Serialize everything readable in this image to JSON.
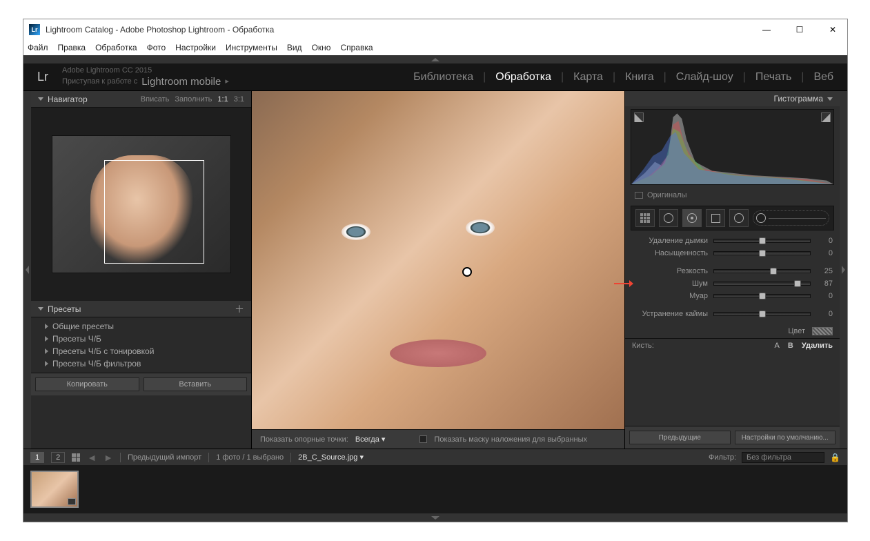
{
  "window": {
    "title": "Lightroom Catalog - Adobe Photoshop Lightroom - Обработка"
  },
  "menubar": [
    "Файл",
    "Правка",
    "Обработка",
    "Фото",
    "Настройки",
    "Инструменты",
    "Вид",
    "Окно",
    "Справка"
  ],
  "branding": {
    "version": "Adobe Lightroom CC 2015",
    "mobile_prefix": "Приступая к работе с",
    "mobile": "Lightroom mobile"
  },
  "modules": [
    "Библиотека",
    "Обработка",
    "Карта",
    "Книга",
    "Слайд-шоу",
    "Печать",
    "Веб"
  ],
  "active_module": "Обработка",
  "navigator": {
    "title": "Навигатор",
    "zoom": [
      "Вписать",
      "Заполнить",
      "1:1",
      "3:1"
    ],
    "zoom_active": "1:1"
  },
  "presets": {
    "title": "Пресеты",
    "items": [
      "Общие пресеты",
      "Пресеты Ч/Б",
      "Пресеты Ч/Б с тонировкой",
      "Пресеты Ч/Б фильтров"
    ]
  },
  "left_buttons": {
    "copy": "Копировать",
    "paste": "Вставить"
  },
  "center_bar": {
    "anchor_label": "Показать опорные точки:",
    "anchor_value": "Всегда",
    "mask_label": "Показать маску наложения для выбранных"
  },
  "right": {
    "histogram_title": "Гистограмма",
    "originals": "Оригиналы",
    "sliders": [
      {
        "label": "Удаление дымки",
        "value": 0,
        "pos": 50
      },
      {
        "label": "Насыщенность",
        "value": 0,
        "pos": 50
      },
      {
        "label": "Резкость",
        "value": 25,
        "pos": 62
      },
      {
        "label": "Шум",
        "value": 87,
        "pos": 87,
        "highlight": true
      },
      {
        "label": "Муар",
        "value": 0,
        "pos": 50
      },
      {
        "label": "Устранение каймы",
        "value": 0,
        "pos": 50
      }
    ],
    "color_label": "Цвет",
    "brush_label": "Кисть:",
    "brush_a": "A",
    "brush_b": "B",
    "brush_delete": "Удалить",
    "prev": "Предыдущие",
    "defaults": "Настройки по умолчанию..."
  },
  "filmstrip": {
    "view1": "1",
    "view2": "2",
    "prev_import": "Предыдущий импорт",
    "count": "1 фото  /  1 выбрано",
    "filename": "2B_C_Source.jpg",
    "filter_label": "Фильтр:",
    "filter_value": "Без фильтра"
  }
}
